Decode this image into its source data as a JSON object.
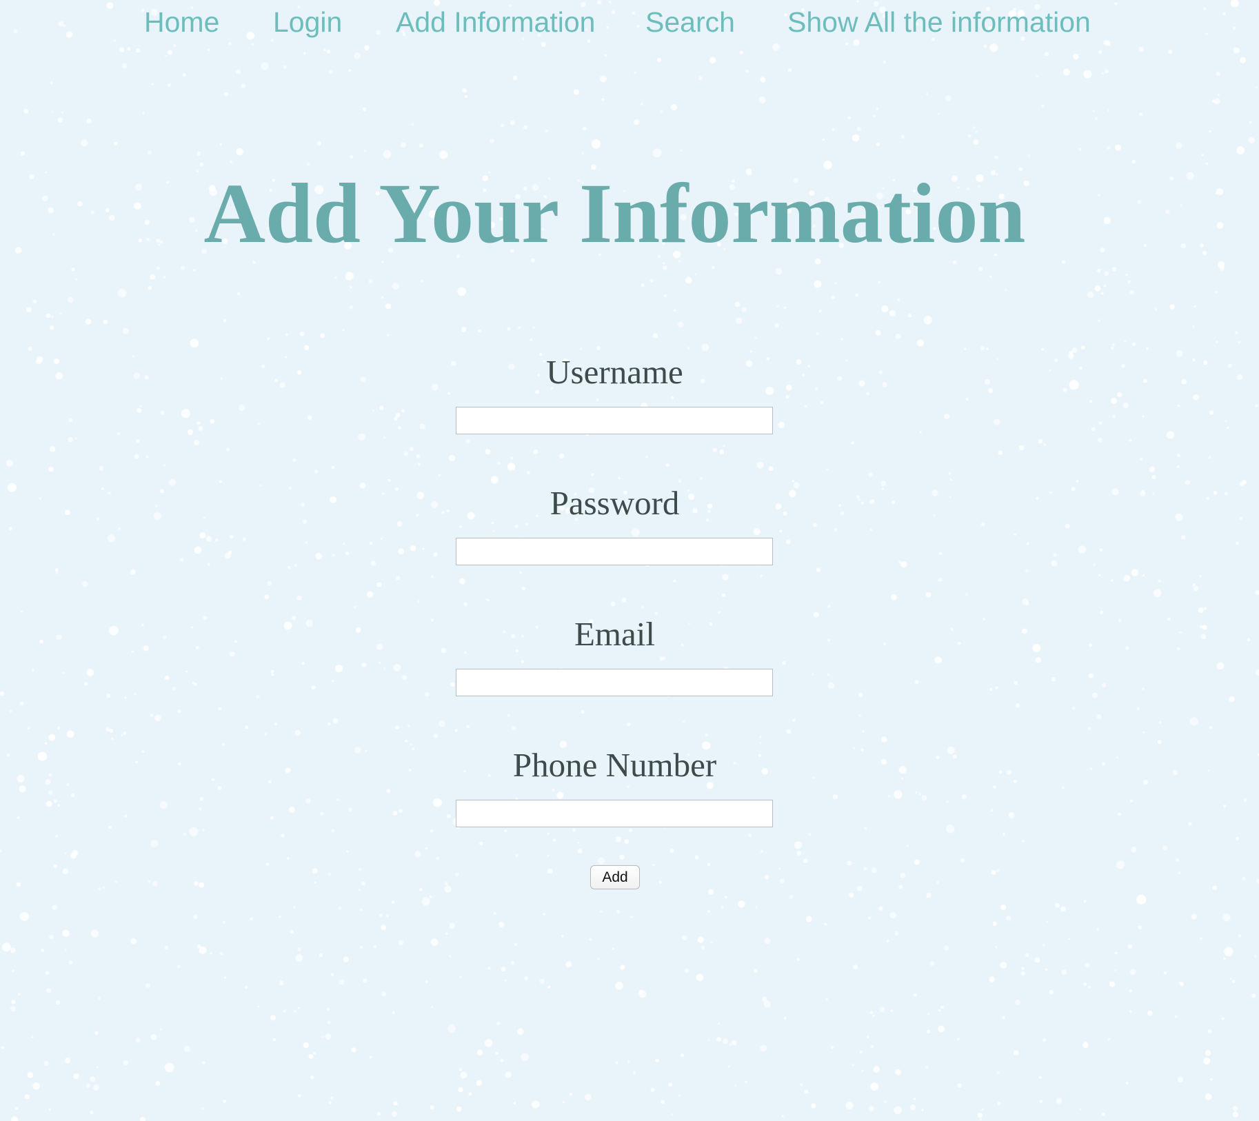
{
  "nav": {
    "items": [
      {
        "label": "Home"
      },
      {
        "label": "Login"
      },
      {
        "label": "Add Information"
      },
      {
        "label": "Search"
      },
      {
        "label": "Show All the information"
      }
    ]
  },
  "page": {
    "title": "Add Your Information"
  },
  "form": {
    "fields": [
      {
        "label": "Username",
        "value": ""
      },
      {
        "label": "Password",
        "value": ""
      },
      {
        "label": "Email",
        "value": ""
      },
      {
        "label": "Phone Number",
        "value": ""
      }
    ],
    "submit_label": "Add"
  },
  "colors": {
    "background": "#e8f3fa",
    "nav_link": "#6dbdbd",
    "title": "#6aabab",
    "label": "#3d4b4a"
  }
}
